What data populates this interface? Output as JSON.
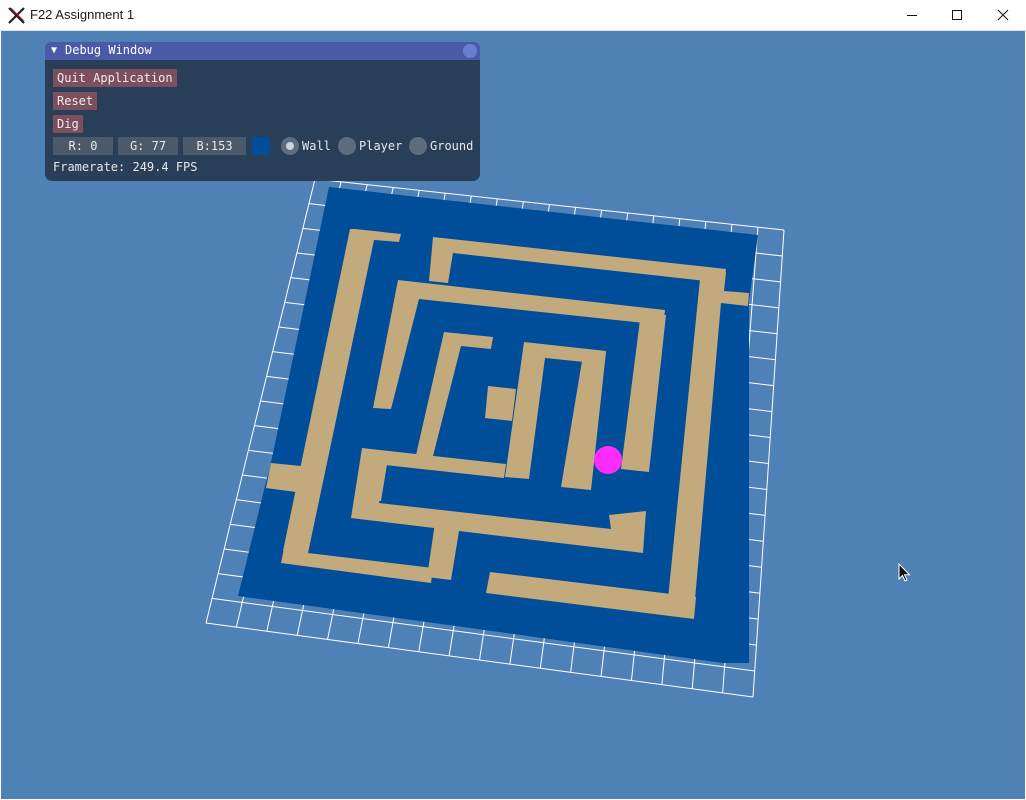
{
  "window": {
    "title": "F22 Assignment 1",
    "controls": [
      "minimize",
      "maximize",
      "close"
    ]
  },
  "debug_window": {
    "title": "Debug Window",
    "buttons": {
      "quit": "Quit Application",
      "reset": "Reset",
      "dig": "Dig"
    },
    "color": {
      "r_label": "R:  0",
      "g_label": "G: 77",
      "b_label": "B:153",
      "r": 0,
      "g": 77,
      "b": 153,
      "swatch_hex": "#004d99"
    },
    "radio_options": [
      {
        "label": "Wall",
        "selected": true
      },
      {
        "label": "Player",
        "selected": false
      },
      {
        "label": "Ground",
        "selected": false
      }
    ],
    "framerate_label": "Framerate:",
    "framerate_value": "249.4 FPS"
  },
  "scene": {
    "background_color": "#4f81b7",
    "wall_color": "#004d99",
    "ground_color": "#c2aa7c",
    "player_color": "#ff2bff",
    "grid_color": "#ffffff",
    "grid_size": 18
  }
}
